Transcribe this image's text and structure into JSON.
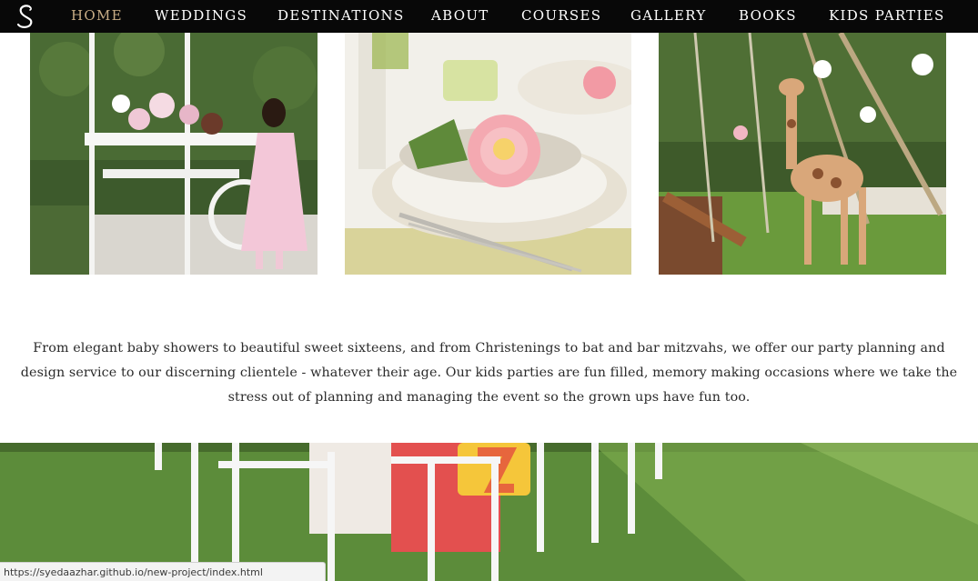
{
  "nav": {
    "logo_icon": "swan-s-logo-icon",
    "items": [
      {
        "label": "HOME",
        "active": true
      },
      {
        "label": "WEDDINGS",
        "active": false
      },
      {
        "label": "DESTINATIONS",
        "active": false
      },
      {
        "label": "ABOUT",
        "active": false
      },
      {
        "label": "COURSES",
        "active": false
      },
      {
        "label": "GALLERY",
        "active": false
      },
      {
        "label": "BOOKS",
        "active": false
      },
      {
        "label": "KIDS PARTIES",
        "active": false
      }
    ],
    "active_color": "#c8ad86",
    "background": "#080808"
  },
  "gallery": {
    "photos": [
      {
        "subject": "girl-at-flower-cart-photo"
      },
      {
        "subject": "peony-place-setting-photo"
      },
      {
        "subject": "giraffe-garden-party-photo"
      }
    ]
  },
  "intro": {
    "text": "From elegant baby showers to beautiful sweet sixteens, and from Christenings to bat and bar mitzvahs, we offer our party planning and design service to our discerning clientele - whatever their age. Our kids parties are fun filled, memory making occasions where we take the stress out of planning and managing the event so the grown ups have fun too."
  },
  "banner": {
    "subject": "lawn-party-chairs-photo"
  },
  "status_bar": {
    "url": "https://syedaazhar.github.io/new-project/index.html"
  }
}
